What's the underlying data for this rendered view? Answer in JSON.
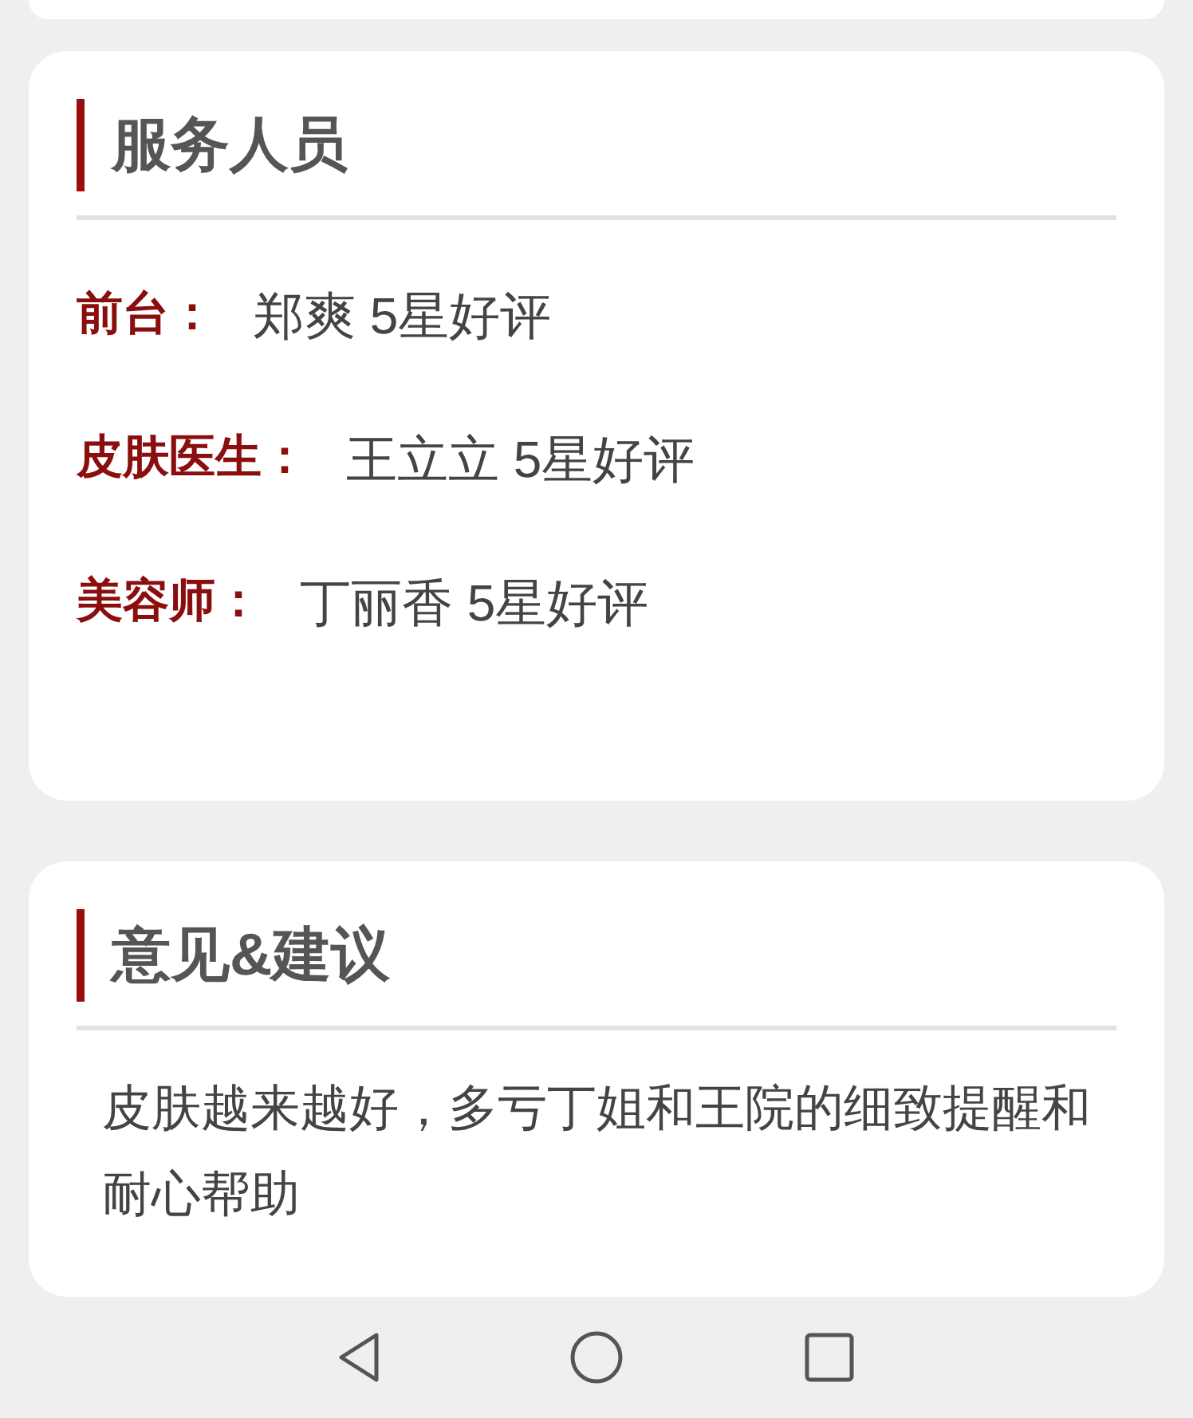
{
  "staff_card": {
    "title": "服务人员",
    "rows": [
      {
        "label": "前台：",
        "value": "郑爽 5星好评"
      },
      {
        "label": "皮肤医生：",
        "value": "王立立 5星好评"
      },
      {
        "label": "美容师：",
        "value": "丁丽香 5星好评"
      }
    ]
  },
  "feedback_card": {
    "title": "意见&建议",
    "text": "皮肤越来越好，多亏丁姐和王院的细致提醒和耐心帮助"
  },
  "nav_bar": {
    "buttons": [
      {
        "kind": "back"
      },
      {
        "kind": "home"
      },
      {
        "kind": "recents"
      }
    ]
  }
}
